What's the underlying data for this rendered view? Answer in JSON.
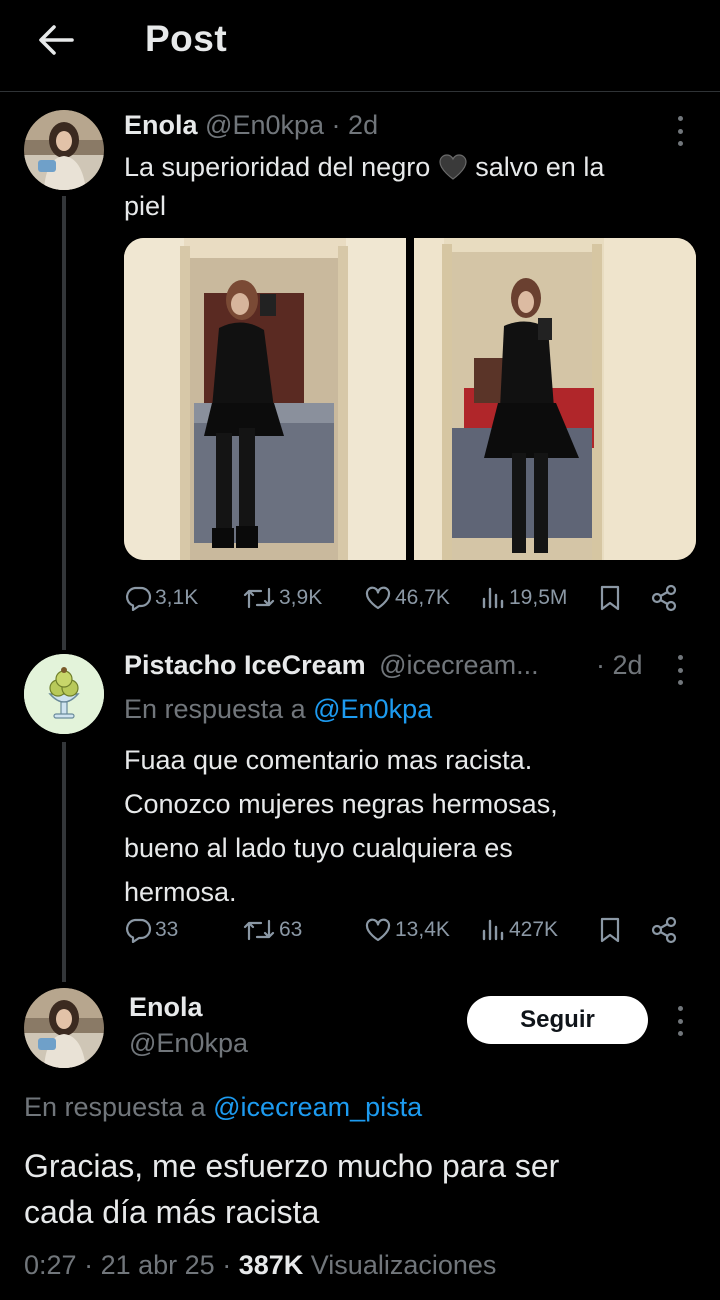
{
  "header": {
    "title": "Post"
  },
  "post": {
    "author_name": "Enola",
    "handle": "@En0kpa",
    "sep": "·",
    "age": "2d",
    "text_before_emoji": "La superioridad del negro",
    "emoji": "black-heart",
    "text_after_emoji": "salvo en la",
    "text_line2": "piel",
    "stats": {
      "replies": "3,1K",
      "reposts": "3,9K",
      "likes": "46,7K",
      "views": "19,5M"
    }
  },
  "reply": {
    "author_name": "Pistacho IceCream",
    "handle": "@icecream...",
    "sep": "·",
    "age": "2d",
    "in_reply_label": "En respuesta a",
    "in_reply_handle": "@En0kpa",
    "text_lines": [
      "Fuaa que comentario mas racista.",
      "Conozco mujeres negras hermosas,",
      "bueno al lado tuyo cualquiera es",
      "hermosa."
    ],
    "stats": {
      "replies": "33",
      "reposts": "63",
      "likes": "13,4K",
      "views": "427K"
    }
  },
  "main": {
    "author_name": "Enola",
    "handle": "@En0kpa",
    "follow_label": "Seguir",
    "in_reply_label": "En respuesta a",
    "in_reply_handle": "@icecream_pista",
    "text_lines": [
      "Gracias, me esfuerzo mucho para ser",
      "cada día más racista"
    ],
    "time": "0:27",
    "sep1": "·",
    "date": "21 abr 25",
    "sep2": "·",
    "views_count": "387K",
    "views_label": "Visualizaciones"
  },
  "icons": [
    "back-arrow-icon",
    "more-icon",
    "reply-icon",
    "repost-icon",
    "like-icon",
    "views-icon",
    "bookmark-icon",
    "share-icon"
  ],
  "colors": {
    "background": "#000000",
    "text": "#e7e9ea",
    "muted": "#71767b",
    "link": "#1d9bf0",
    "follow_button": "#ffffff"
  }
}
